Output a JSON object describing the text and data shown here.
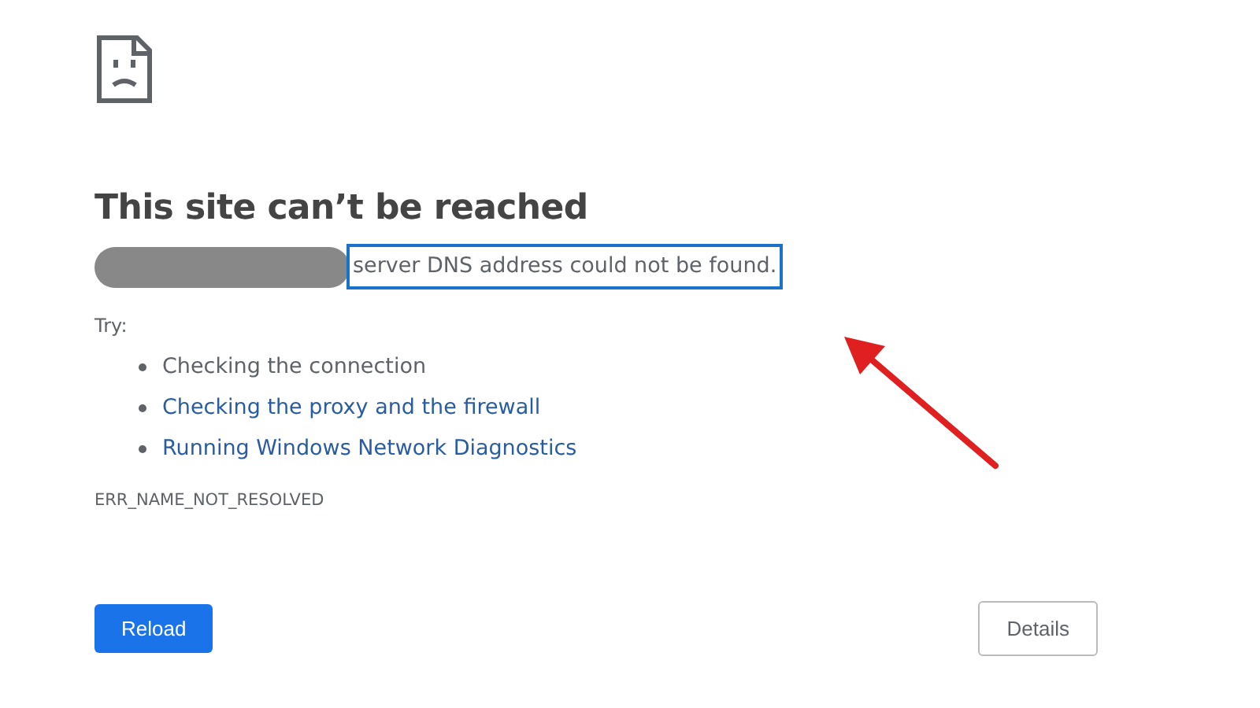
{
  "title": "This site can’t be reached",
  "message": "server DNS address could not be found.",
  "try_label": "Try:",
  "suggestions": [
    {
      "text": "Checking the connection",
      "kind": "text"
    },
    {
      "text": "Checking the proxy and the firewall",
      "kind": "link"
    },
    {
      "text": "Running Windows Network Diagnostics",
      "kind": "link"
    }
  ],
  "error_code": "ERR_NAME_NOT_RESOLVED",
  "buttons": {
    "reload": "Reload",
    "details": "Details"
  }
}
